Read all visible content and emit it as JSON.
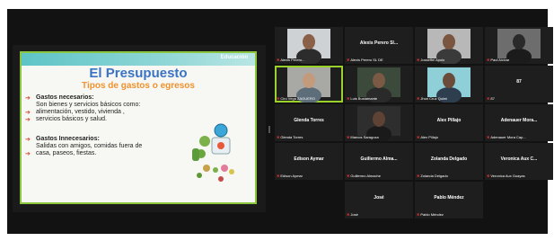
{
  "slide": {
    "logo": "Educación",
    "title": "El Presupuesto",
    "subtitle": "Tipos de gastos o egresos",
    "section1_title": "Gastos  necesarios:",
    "section1_lines": [
      "Son bienes y servicios básicos como:",
      "alimentación, vestido, vivienda ,",
      "servicios básicos y salud."
    ],
    "section2_title": "Gastos Innecesarios:",
    "section2_lines": [
      "Salidas con amigos, comidas fuera de",
      "casa, paseos, fiestas."
    ]
  },
  "participants": [
    {
      "center": "",
      "foot": "Alexis Perero...",
      "video": true
    },
    {
      "center": "Alexis Perero Sl...",
      "foot": "Alexis Perero SL DE",
      "video": false
    },
    {
      "center": "",
      "foot": "Josseffei Apolo",
      "video": true
    },
    {
      "center": "",
      "foot": "Paul Alcivar",
      "video": true
    },
    {
      "center": "",
      "foot": "Ciro Vega ZAGUERO",
      "video": true
    },
    {
      "center": "",
      "foot": "Luis Bustamante",
      "video": true
    },
    {
      "center": "",
      "foot": "Jhon Cruz Quimi",
      "video": true
    },
    {
      "center": "87",
      "foot": "87",
      "video": false
    },
    {
      "center": "Glenda Torres",
      "foot": "Glenda Torres",
      "video": false
    },
    {
      "center": "",
      "foot": "Marcos Saragoza",
      "video": true
    },
    {
      "center": "Alex Pillajo",
      "foot": "Alex Pillajo",
      "video": false
    },
    {
      "center": "Adenauer Mora...",
      "foot": "Adenauer Mora Cap...",
      "video": false
    },
    {
      "center": "Edison Aymar",
      "foot": "Edison Aymar",
      "video": false
    },
    {
      "center": "Guillermo Alma...",
      "foot": "Guillermo Almache",
      "video": false
    },
    {
      "center": "Zolanda Delgado",
      "foot": "Zolanda Delgado",
      "video": false
    },
    {
      "center": "Veronica Aux C...",
      "foot": "Veronica Aux Guayas",
      "video": false
    },
    {
      "center": "José",
      "foot": "José",
      "video": false
    },
    {
      "center": "Pablo Méndez",
      "foot": "Pablo Méndez",
      "video": false
    }
  ],
  "colors": {
    "active_speaker": "#9ad12a",
    "mic_muted": "#e33333"
  }
}
